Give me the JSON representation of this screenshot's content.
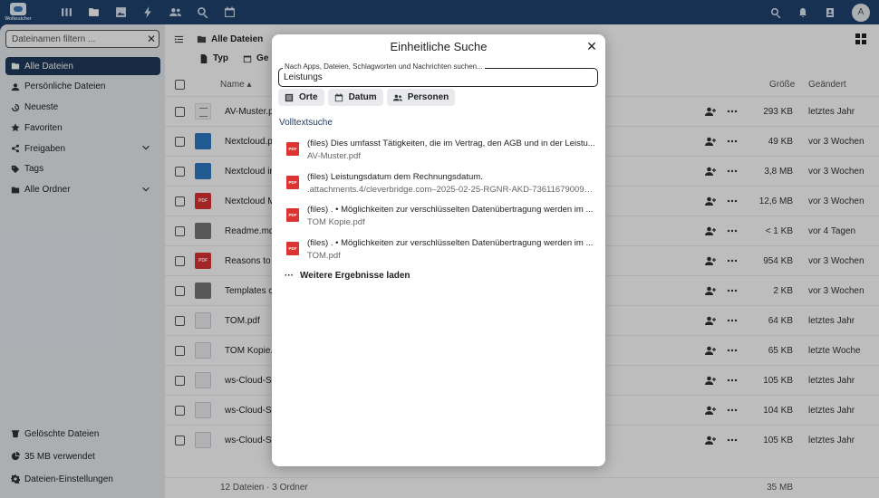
{
  "topbar": {
    "logo_text": "Wolkesicher",
    "apps": [
      "dashboard-icon",
      "files-icon",
      "photos-icon",
      "activity-icon",
      "contacts-icon",
      "search-icon",
      "calendar-icon"
    ],
    "avatar_initial": "A"
  },
  "sidebar": {
    "filter_placeholder": "Dateinamen filtern ...",
    "items": [
      {
        "label": "Alle Dateien",
        "icon": "folder-icon",
        "active": true
      },
      {
        "label": "Persönliche Dateien",
        "icon": "account-icon"
      },
      {
        "label": "Neueste",
        "icon": "history-icon"
      },
      {
        "label": "Favoriten",
        "icon": "star-icon"
      },
      {
        "label": "Freigaben",
        "icon": "share-icon",
        "expandable": true
      },
      {
        "label": "Tags",
        "icon": "tag-icon"
      },
      {
        "label": "Alle Ordner",
        "icon": "folder-icon",
        "expandable": true
      }
    ],
    "bottom": [
      {
        "label": "Gelöschte Dateien",
        "icon": "trash-icon"
      },
      {
        "label": "35 MB verwendet",
        "icon": "pie-chart-icon"
      },
      {
        "label": "Dateien-Einstellungen",
        "icon": "gear-icon"
      }
    ]
  },
  "main": {
    "breadcrumb": "Alle Dateien",
    "filters": {
      "type_label": "Typ",
      "modified_label": "Ge"
    },
    "columns": {
      "name": "Name",
      "size": "Größe",
      "modified": "Geändert"
    },
    "rows": [
      {
        "name": "AV-Muster.p",
        "icon": "doc",
        "size": "293 KB",
        "modified": "letztes Jahr"
      },
      {
        "name": "Nextcloud.pr",
        "icon": "nc",
        "size": "49 KB",
        "modified": "vor 3 Wochen"
      },
      {
        "name": "Nextcloud in",
        "icon": "nc",
        "size": "3,8 MB",
        "modified": "vor 3 Wochen"
      },
      {
        "name": "Nextcloud M",
        "icon": "pdf",
        "size": "12,6 MB",
        "modified": "vor 3 Wochen"
      },
      {
        "name": "Readme.md",
        "icon": "md",
        "size": "< 1 KB",
        "modified": "vor 4 Tagen"
      },
      {
        "name": "Reasons to u",
        "icon": "pdf",
        "size": "954 KB",
        "modified": "vor 3 Wochen"
      },
      {
        "name": "Templates cr",
        "icon": "md",
        "size": "2 KB",
        "modified": "vor 3 Wochen"
      },
      {
        "name": "TOM.pdf",
        "icon": "img",
        "size": "64 KB",
        "modified": "letztes Jahr"
      },
      {
        "name": "TOM Kopie.p",
        "icon": "img",
        "size": "65 KB",
        "modified": "letzte Woche"
      },
      {
        "name": "ws-Cloud-Se",
        "icon": "img",
        "size": "105 KB",
        "modified": "letztes Jahr"
      },
      {
        "name": "ws-Cloud-Se",
        "icon": "img",
        "size": "104 KB",
        "modified": "letztes Jahr"
      },
      {
        "name": "ws-Cloud-Se",
        "icon": "img",
        "size": "105 KB",
        "modified": "letztes Jahr"
      }
    ],
    "summary": "12 Dateien · 3 Ordner",
    "total_size": "35 MB"
  },
  "modal": {
    "title": "Einheitliche Suche",
    "search_label": "Nach Apps, Dateien, Schlagworten und Nachrichten suchen...",
    "search_value": "Leistungs",
    "chips": [
      {
        "label": "Orte",
        "icon": "list-icon"
      },
      {
        "label": "Datum",
        "icon": "calendar-icon"
      },
      {
        "label": "Personen",
        "icon": "people-icon"
      }
    ],
    "section": "Volltextsuche",
    "results": [
      {
        "title": "(files) Dies umfasst Tätigkeiten, die im Vertrag, den AGB und in der Leistu...",
        "sub": "AV-Muster.pdf"
      },
      {
        "title": "(files) Leistungsdatum dem Rechnungsdatum.",
        "sub": ".attachments.4/cleverbridge.com–2025-02-25-RGNR-AKD-736116790096_..."
      },
      {
        "title": "(files) . • Möglichkeiten zur verschlüsselten Datenübertragung werden im ...",
        "sub": "TOM Kopie.pdf"
      },
      {
        "title": "(files) . • Möglichkeiten zur verschlüsselten Datenübertragung werden im ...",
        "sub": "TOM.pdf"
      }
    ],
    "pdf_badge": "PDF",
    "more_label": "Weitere Ergebnisse laden",
    "more_dots": "···"
  }
}
